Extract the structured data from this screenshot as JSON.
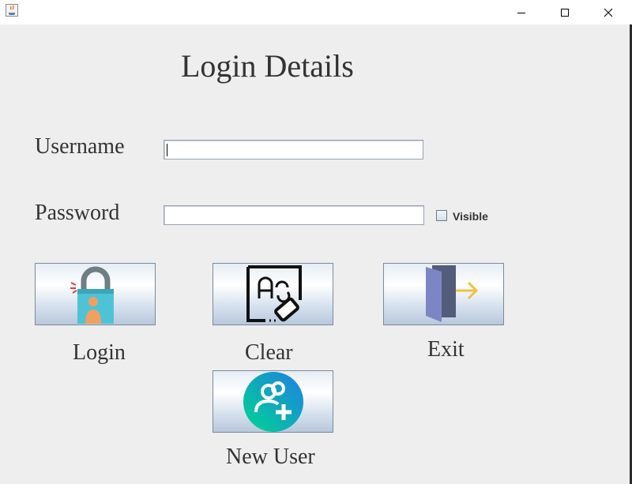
{
  "window": {
    "title": "",
    "controls": [
      "minimize-icon",
      "maximize-icon",
      "close-icon"
    ]
  },
  "form": {
    "heading": "Login Details",
    "username": {
      "label": "Username",
      "value": ""
    },
    "password": {
      "label": "Password",
      "value": ""
    },
    "visible_checkbox": {
      "label": "Visible",
      "checked": false
    }
  },
  "buttons": {
    "login": {
      "label": "Login",
      "icon": "padlock-user-icon"
    },
    "clear": {
      "label": "Clear",
      "icon": "eraser-text-icon"
    },
    "exit": {
      "label": "Exit",
      "icon": "door-exit-icon"
    },
    "new_user": {
      "label": "New User",
      "icon": "add-user-icon"
    }
  }
}
